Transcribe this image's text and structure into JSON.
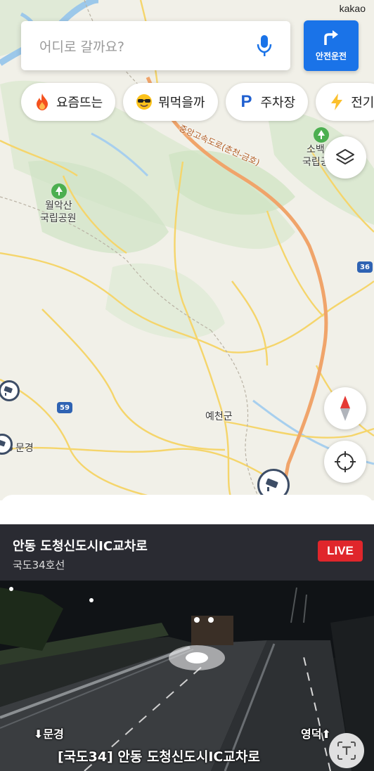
{
  "map": {
    "logo": "kakao",
    "labels": {
      "highway": "중앙고속도로(춘천-금호)",
      "park_wolak_1": "월악산",
      "park_wolak_2": "국립공원",
      "park_sobaek_1": "소백",
      "park_sobaek_2": "국립공",
      "yecheon": "예천군",
      "mungyeong": "문경",
      "route_59": "59",
      "route_36": "36"
    },
    "icons": {
      "layers": "layers-icon",
      "compass": "compass-icon",
      "location": "crosshair-icon",
      "cctv": "cctv-camera-icon"
    }
  },
  "search": {
    "placeholder": "어디로 갈까요?",
    "mic_icon": "microphone-icon"
  },
  "safe_drive": {
    "label": "안전운전",
    "icon": "turn-right-arrow-icon"
  },
  "chips": [
    {
      "label": "요즘뜨는",
      "icon": "fire-icon"
    },
    {
      "label": "뭐먹을까",
      "icon": "sunglasses-emoji-icon"
    },
    {
      "label": "주차장",
      "icon": "parking-p-icon"
    },
    {
      "label": "전기",
      "icon": "lightning-icon"
    }
  ],
  "cctv_panel": {
    "title": "안동 도청신도시IC교차로",
    "subtitle": "국도34호선",
    "live_badge": "LIVE",
    "overlay_left": "문경",
    "overlay_right": "영덕",
    "overlay_caption": "[국도34]  안동  도청신도시IC교차로",
    "text_button_icon": "text-recognition-icon"
  },
  "colors": {
    "primary_blue": "#1a73e8",
    "live_red": "#e0262b",
    "highway_orange": "#f0a46a",
    "road_yellow": "#f5d56b"
  }
}
